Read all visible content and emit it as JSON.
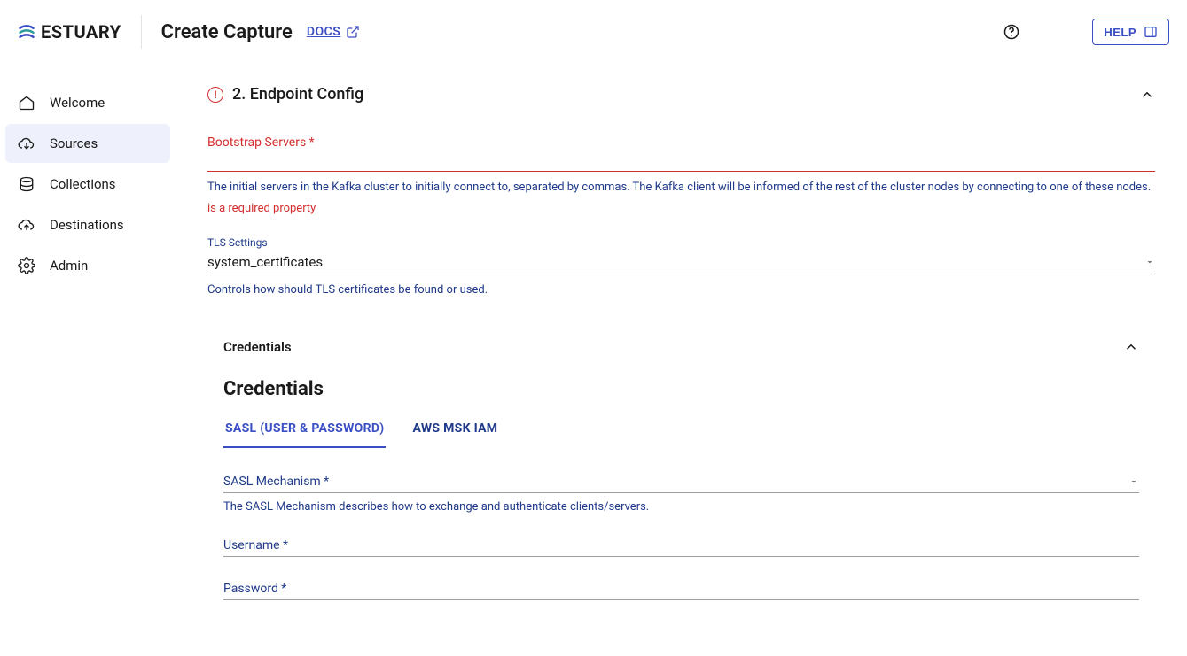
{
  "brand": {
    "name": "ESTUARY"
  },
  "header": {
    "title": "Create Capture",
    "docs_label": "DOCS",
    "help_label": "HELP"
  },
  "sidebar": {
    "items": [
      {
        "label": "Welcome"
      },
      {
        "label": "Sources"
      },
      {
        "label": "Collections"
      },
      {
        "label": "Destinations"
      },
      {
        "label": "Admin"
      }
    ]
  },
  "endpoint": {
    "section_title": "2. Endpoint Config",
    "bootstrap": {
      "label": "Bootstrap Servers *",
      "helper": "The initial servers in the Kafka cluster to initially connect to, separated by commas. The Kafka client will be informed of the rest of the cluster nodes by connecting to one of these nodes.",
      "error": "is a required property"
    },
    "tls": {
      "label": "TLS Settings",
      "value": "system_certificates",
      "helper": "Controls how should TLS certificates be found or used."
    }
  },
  "credentials": {
    "panel_title": "Credentials",
    "heading": "Credentials",
    "tabs": [
      {
        "label": "SASL (USER & PASSWORD)"
      },
      {
        "label": "AWS MSK IAM"
      }
    ],
    "sasl_mechanism": {
      "label": "SASL Mechanism *",
      "helper": "The SASL Mechanism describes how to exchange and authenticate clients/servers."
    },
    "username": {
      "label": "Username *"
    },
    "password": {
      "label": "Password *"
    }
  }
}
